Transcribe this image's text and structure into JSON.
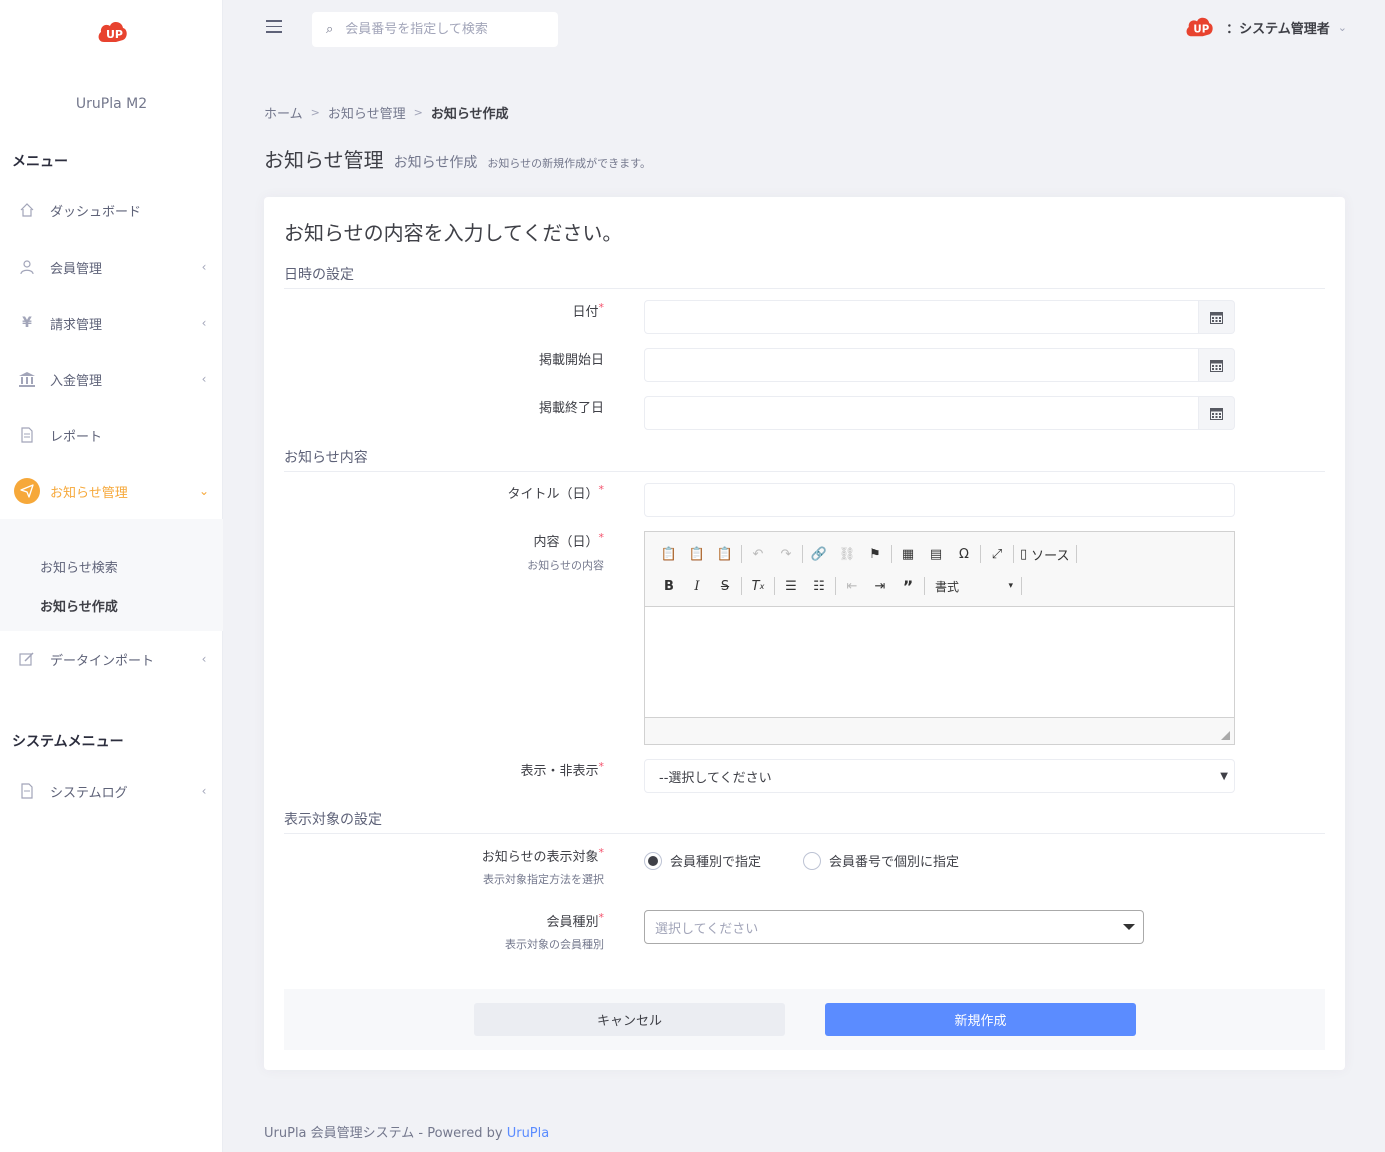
{
  "sidebar": {
    "brand": "UruPla M2",
    "menu_title": "メニュー",
    "items": [
      {
        "label": "ダッシュボード",
        "icon": "home-icon"
      },
      {
        "label": "会員管理",
        "icon": "user-icon"
      },
      {
        "label": "請求管理",
        "icon": "yen-icon"
      },
      {
        "label": "入金管理",
        "icon": "bank-icon"
      },
      {
        "label": "レポート",
        "icon": "document-icon"
      },
      {
        "label": "お知らせ管理",
        "icon": "send-icon"
      },
      {
        "label": "データインポート",
        "icon": "edit-icon"
      }
    ],
    "submenu": [
      "お知らせ検索",
      "お知らせ作成"
    ],
    "system_title": "システムメニュー",
    "system_items": [
      {
        "label": "システムログ",
        "icon": "log-icon"
      }
    ]
  },
  "topbar": {
    "search_placeholder": "会員番号を指定して検索",
    "user_name": "：システム管理者"
  },
  "breadcrumb": [
    "ホーム",
    "お知らせ管理",
    "お知らせ作成"
  ],
  "breadcrumb_sep": ">",
  "page": {
    "title": "お知らせ管理",
    "subtitle": "お知らせ作成",
    "description": "お知らせの新規作成ができます。"
  },
  "form": {
    "heading": "お知らせの内容を入力してください。",
    "required_mark": "*",
    "section_datetime": "日時の設定",
    "date_label": "日付",
    "start_label": "掲載開始日",
    "end_label": "掲載終了日",
    "section_content": "お知らせ内容",
    "title_label": "タイトル（日）",
    "content_label": "内容（日）",
    "content_help": "お知らせの内容",
    "editor": {
      "source_label": "ソース",
      "format_label": "書式"
    },
    "visibility_label": "表示・非表示",
    "visibility_value": "--選択してください",
    "section_target": "表示対象の設定",
    "target_label": "お知らせの表示対象",
    "target_help": "表示対象指定方法を選択",
    "target_options": [
      "会員種別で指定",
      "会員番号で個別に指定"
    ],
    "member_type_label": "会員種別",
    "member_type_help": "表示対象の会員種別",
    "member_type_placeholder": "選択してください",
    "cancel_label": "キャンセル",
    "create_label": "新規作成"
  },
  "footer": {
    "text": "UruPla 会員管理システム - Powered by ",
    "link": "UruPla"
  },
  "colors": {
    "accent": "#f6a83a",
    "primary": "#5b8cff",
    "required": "#f4516c",
    "logo": "#e8432f"
  }
}
